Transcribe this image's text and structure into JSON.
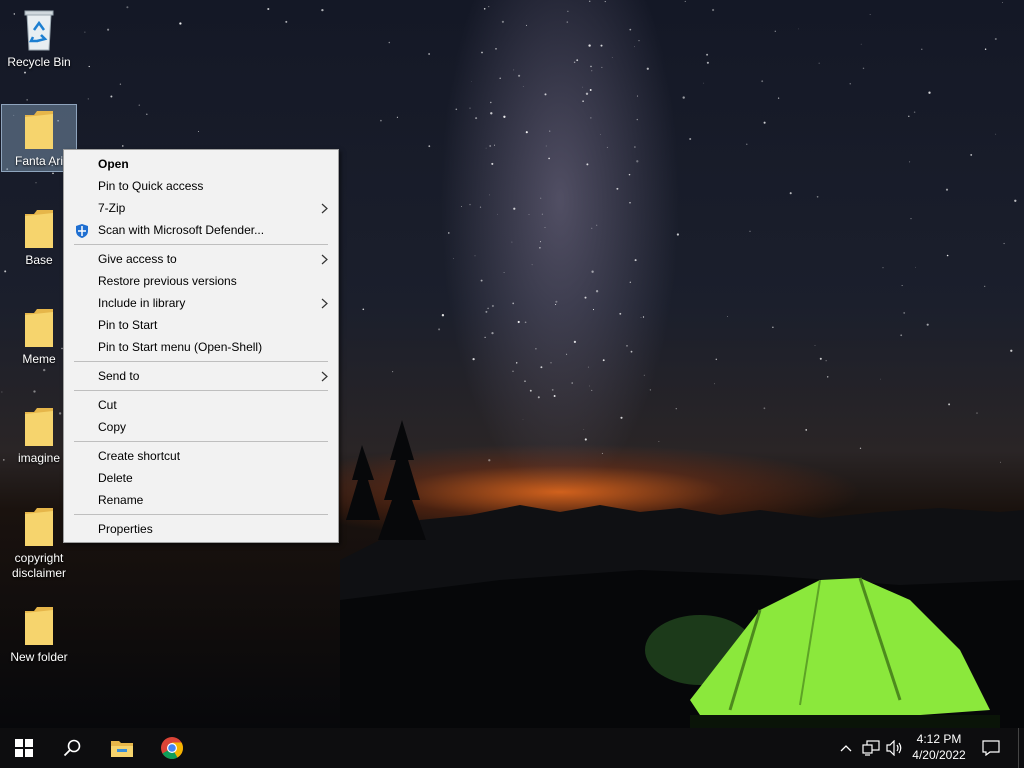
{
  "desktop": {
    "icons": [
      {
        "label": "Recycle Bin",
        "icon": "recycle-bin-icon"
      },
      {
        "label": "Fanta Ari",
        "icon": "folder-icon"
      },
      {
        "label": "Base",
        "icon": "folder-icon"
      },
      {
        "label": "Meme",
        "icon": "folder-icon"
      },
      {
        "label": "imagine",
        "icon": "folder-icon"
      },
      {
        "label": "copyright disclaimer",
        "icon": "folder-icon"
      },
      {
        "label": "New folder",
        "icon": "folder-icon"
      }
    ]
  },
  "context_menu": {
    "items": {
      "open": "Open",
      "pin_quick": "Pin to Quick access",
      "zip": "7-Zip",
      "scan": "Scan with Microsoft Defender...",
      "give_access": "Give access to",
      "restore": "Restore previous versions",
      "include_library": "Include in library",
      "pin_start": "Pin to Start",
      "pin_start_shell": "Pin to Start menu (Open-Shell)",
      "send_to": "Send to",
      "cut": "Cut",
      "copy": "Copy",
      "create_shortcut": "Create shortcut",
      "delete": "Delete",
      "rename": "Rename",
      "properties": "Properties"
    }
  },
  "taskbar": {
    "time": "4:12 PM",
    "date": "4/20/2022",
    "pinned": [
      "windows-start-icon",
      "search-icon",
      "file-explorer-icon",
      "chrome-icon"
    ],
    "tray": [
      "chevron-up-icon",
      "network-icon",
      "volume-icon",
      "notification-icon"
    ]
  },
  "colors": {
    "menu_bg": "#f2f2f2",
    "taskbar_bg": "#0d0d0f",
    "folder_yellow": "#f6d46d",
    "tent_green": "#8be83c"
  }
}
